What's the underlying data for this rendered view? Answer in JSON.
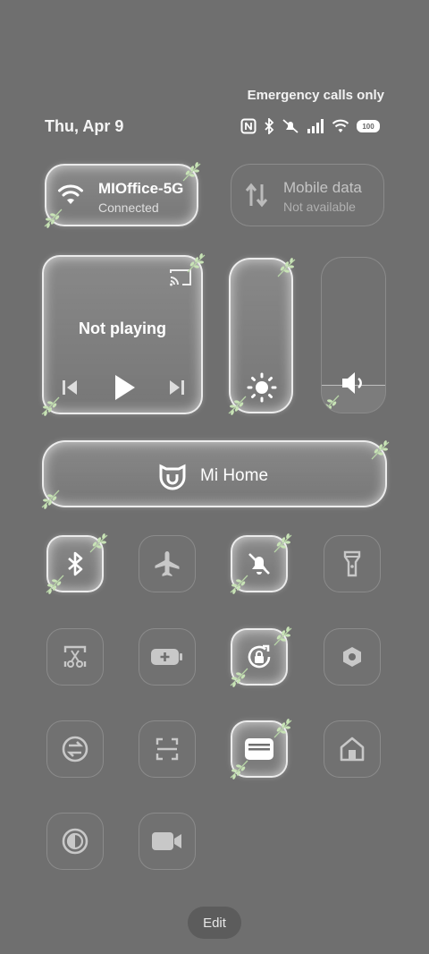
{
  "status_bar": {
    "emergency": "Emergency calls only",
    "date": "Thu, Apr 9",
    "battery": "100",
    "icons": [
      "nfc-icon",
      "bluetooth-icon",
      "mute-icon",
      "signal-icon",
      "wifi-icon",
      "battery-icon"
    ]
  },
  "network": {
    "wifi": {
      "title": "MIOffice-5G",
      "subtitle": "Connected",
      "active": true
    },
    "mobile": {
      "title": "Mobile data",
      "subtitle": "Not available",
      "active": false
    }
  },
  "media": {
    "status": "Not playing"
  },
  "sliders": [
    {
      "name": "brightness",
      "level": 0.22
    },
    {
      "name": "volume",
      "level": 0.2
    }
  ],
  "smart_home": {
    "label": "Mi Home"
  },
  "toggles": [
    {
      "name": "bluetooth",
      "active": true
    },
    {
      "name": "airplane",
      "active": false
    },
    {
      "name": "mute",
      "active": true
    },
    {
      "name": "flashlight",
      "active": false
    },
    {
      "name": "screenshot",
      "active": false
    },
    {
      "name": "battery-saver",
      "active": false
    },
    {
      "name": "rotation-lock",
      "active": true
    },
    {
      "name": "settings",
      "active": false
    },
    {
      "name": "data-saver",
      "active": false
    },
    {
      "name": "scanner",
      "active": false
    },
    {
      "name": "wallet",
      "active": true
    },
    {
      "name": "home",
      "active": false
    },
    {
      "name": "dark-mode",
      "active": false
    },
    {
      "name": "screen-recorder",
      "active": false
    }
  ],
  "footer": {
    "edit_label": "Edit"
  },
  "colors": {
    "background": "#6f6f6f",
    "leaf": "#b9d6a8"
  }
}
